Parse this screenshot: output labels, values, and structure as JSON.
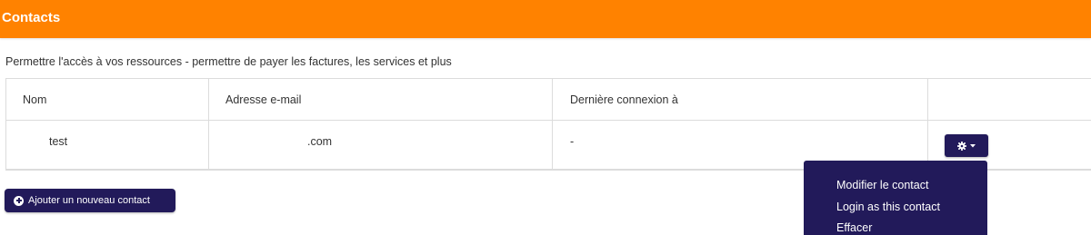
{
  "panel": {
    "title": "Contacts",
    "description": "Permettre l'accès à vos ressources - permettre de payer les factures, les services et plus"
  },
  "table": {
    "headers": [
      "Nom",
      "Adresse e-mail",
      "Dernière connexion à",
      ""
    ],
    "rows": [
      {
        "name": "test",
        "email": ".com",
        "last_login": "-"
      }
    ]
  },
  "actions": {
    "gear_icon": "gear-icon",
    "caret_icon": "caret-down-icon",
    "menu": [
      "Modifier le contact",
      "Login as this contact",
      "Effacer"
    ]
  },
  "add_button": {
    "label": "Ajouter un nouveau contact",
    "icon": "plus-circle-icon"
  },
  "colors": {
    "header_bg": "#ff8200",
    "primary": "#221a5a",
    "border": "#dcdcdc"
  }
}
